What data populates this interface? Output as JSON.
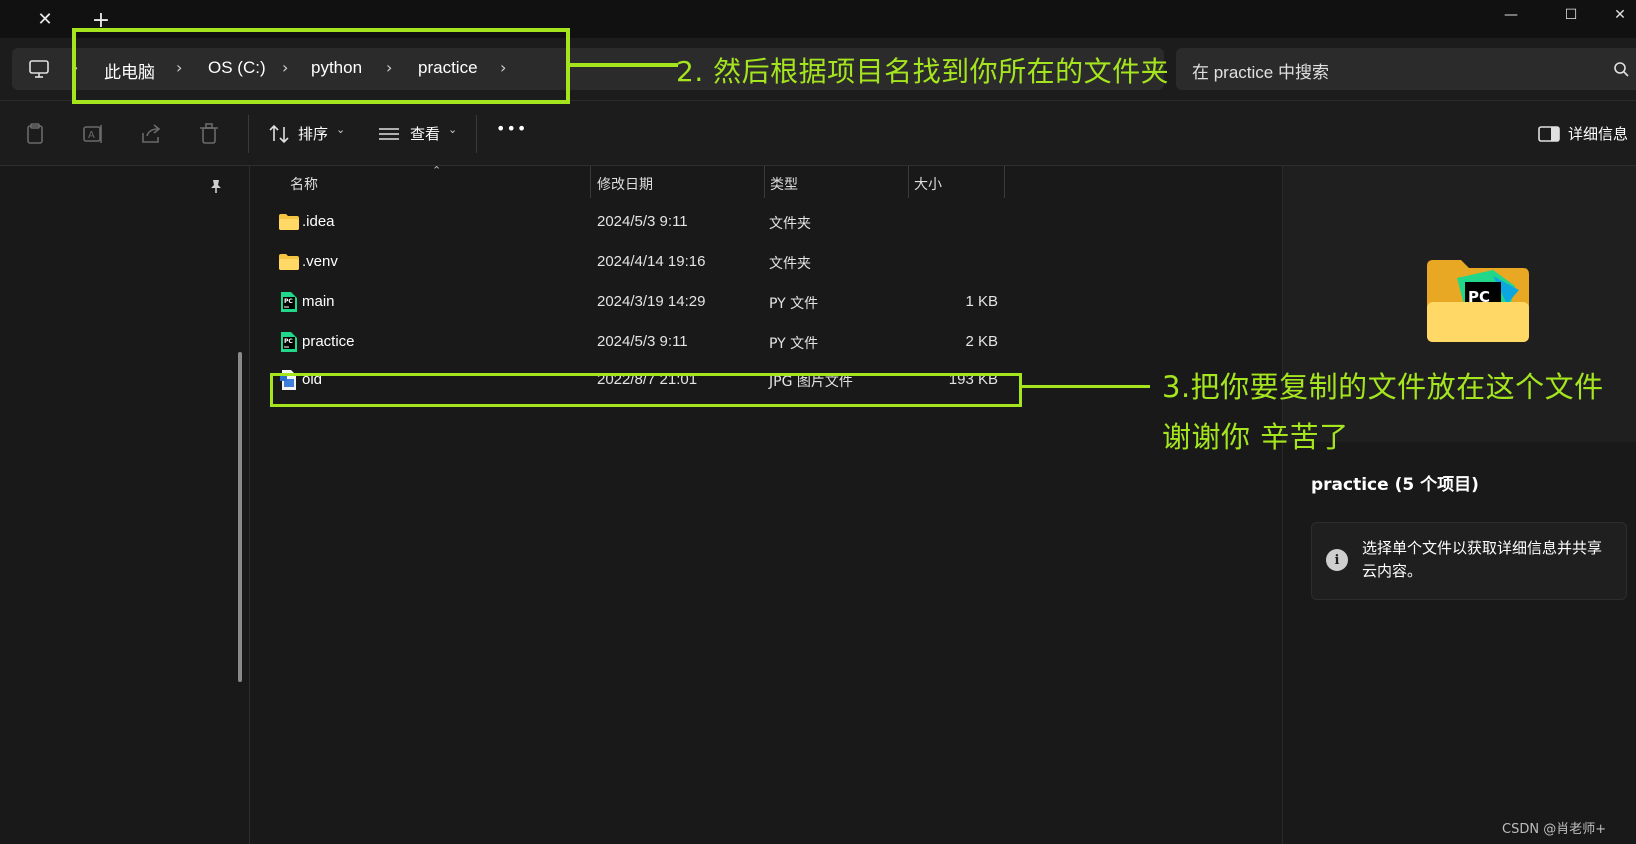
{
  "titlebar": {
    "tab_close_glyph": "✕",
    "tab_new_glyph": "+",
    "minimize_glyph": "—",
    "maximize_glyph": "☐",
    "close_glyph": "✕"
  },
  "address_bar": {
    "breadcrumbs": [
      "此电脑",
      "OS (C:)",
      "python",
      "practice"
    ],
    "chevron": "›"
  },
  "search": {
    "placeholder": "在 practice 中搜索"
  },
  "toolbar": {
    "sort_label": "排序",
    "view_label": "查看",
    "more_glyph": "•••",
    "details_label": "详细信息",
    "caret": "⌄"
  },
  "columns": {
    "name": "名称",
    "modified": "修改日期",
    "type": "类型",
    "size": "大小"
  },
  "files": [
    {
      "name": ".idea",
      "modified": "2024/5/3 9:11",
      "type": "文件夹",
      "size": "",
      "icon": "folder-icon"
    },
    {
      "name": ".venv",
      "modified": "2024/4/14 19:16",
      "type": "文件夹",
      "size": "",
      "icon": "folder-icon"
    },
    {
      "name": "main",
      "modified": "2024/3/19 14:29",
      "type": "PY 文件",
      "size": "1 KB",
      "icon": "pycharm-file-icon"
    },
    {
      "name": "practice",
      "modified": "2024/5/3 9:11",
      "type": "PY 文件",
      "size": "2 KB",
      "icon": "pycharm-file-icon"
    },
    {
      "name": "old",
      "modified": "2022/8/7 21:01",
      "type": "JPG 图片文件",
      "size": "193 KB",
      "icon": "image-file-icon"
    }
  ],
  "details": {
    "title": "practice (5 个项目)",
    "info_glyph": "i",
    "info_text": "选择单个文件以获取详细信息并共享云内容。"
  },
  "annotations": {
    "step2": "2. 然后根据项目名找到你所在的文件夹",
    "step3_line1": "3.把你要复制的文件放在这个文件",
    "step3_line2": "谢谢你 辛苦了"
  },
  "watermark": "CSDN @肖老师+",
  "colors": {
    "annotation": "#a4e51e",
    "background": "#191919",
    "folder": "#f5c542"
  }
}
